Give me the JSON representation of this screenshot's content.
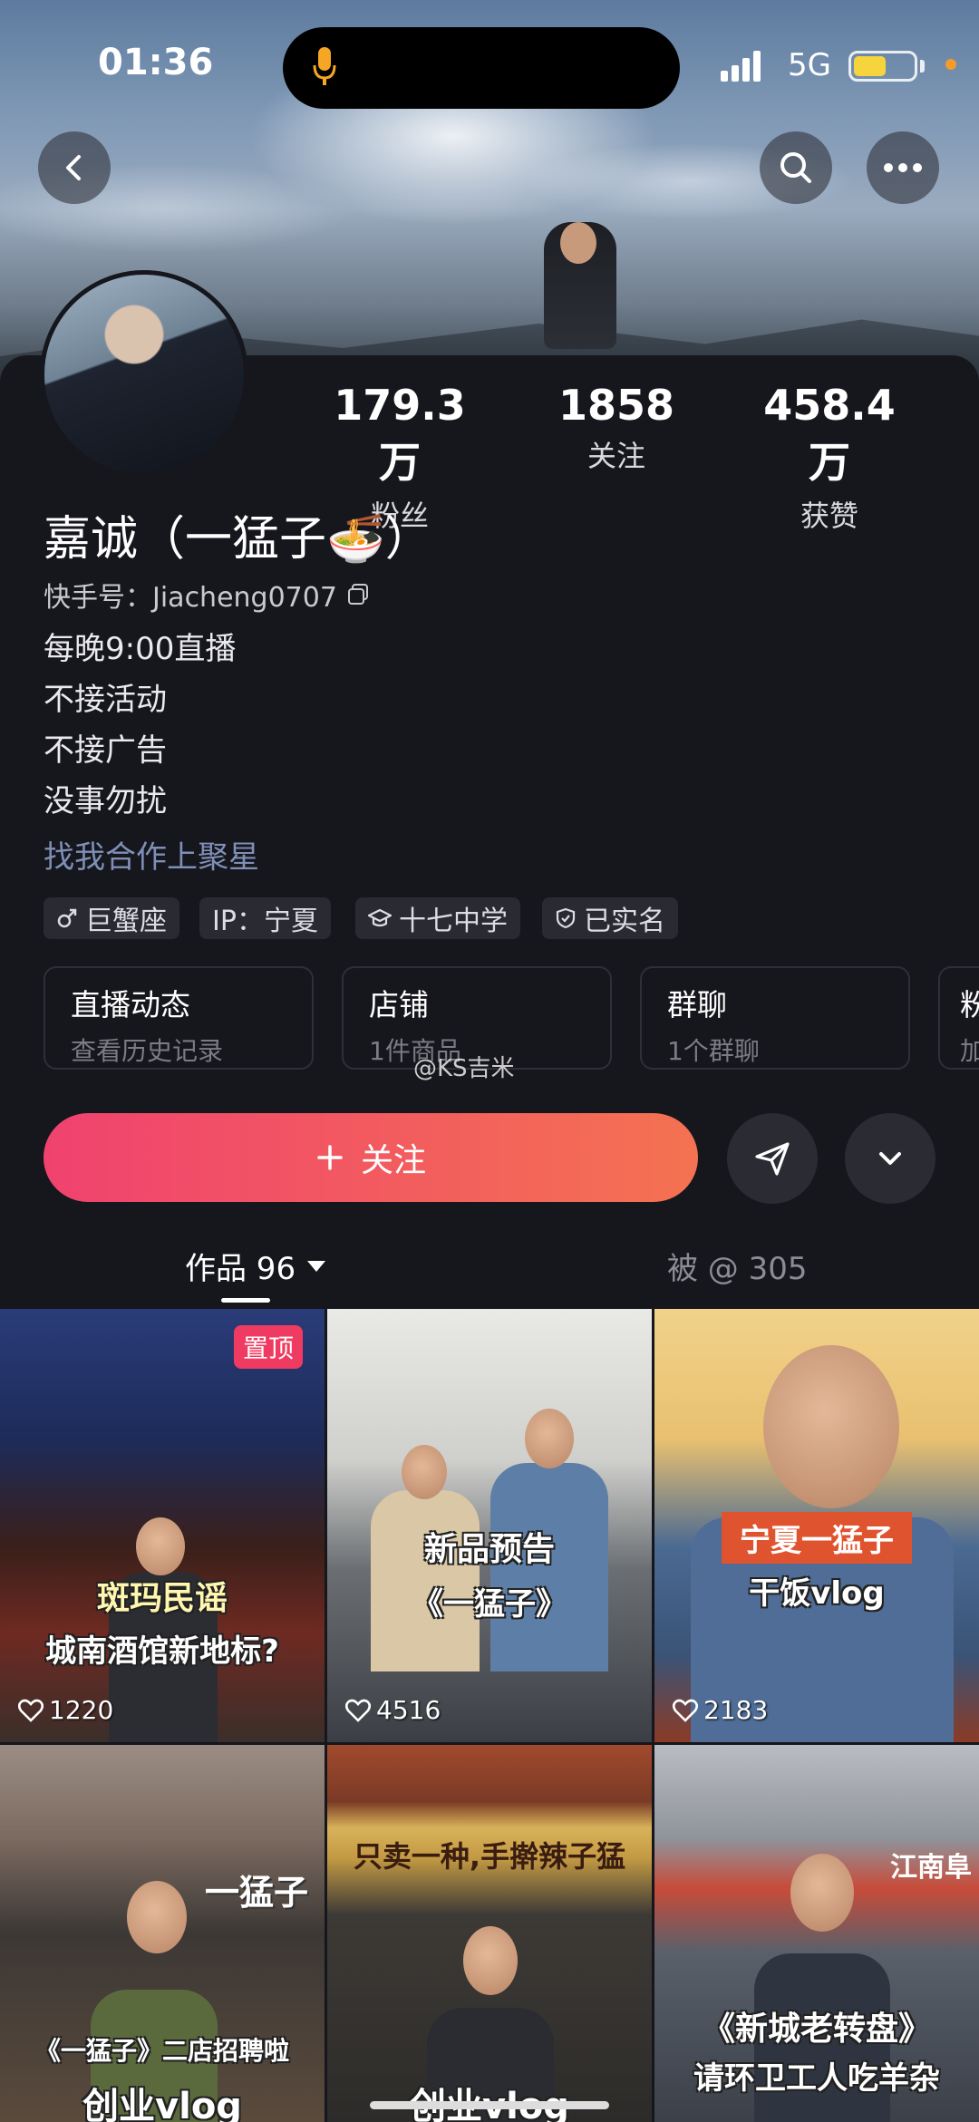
{
  "status_bar": {
    "time": "01:36",
    "network": "5G"
  },
  "profile": {
    "name": "嘉诚（一猛子🍜）",
    "kuaishou_id": "快手号：Jiacheng0707",
    "bio": [
      "每晚9:00直播",
      "不接活动",
      "不接广告",
      "没事勿扰"
    ],
    "link": "找我合作上聚星",
    "stats": [
      {
        "value": "179.3万",
        "label": "粉丝"
      },
      {
        "value": "1858",
        "label": "关注"
      },
      {
        "value": "458.4万",
        "label": "获赞"
      }
    ],
    "tags": [
      "巨蟹座",
      "IP：宁夏",
      "十七中学",
      "已实名"
    ]
  },
  "cards": [
    {
      "title": "直播动态",
      "sub": "查看历史记录"
    },
    {
      "title": "店铺",
      "sub": "1件商品"
    },
    {
      "title": "群聊",
      "sub": "1个群聊"
    },
    {
      "title": "粉",
      "sub": "加"
    }
  ],
  "watermark": "@KS吉米",
  "actions": {
    "follow": "关注"
  },
  "tabs": [
    {
      "label": "作品 96"
    },
    {
      "label": "被 @ 305"
    }
  ],
  "videos": [
    {
      "line1": "斑玛民谣",
      "line2": "城南酒馆新地标?",
      "likes": "1220",
      "pinned": "置顶"
    },
    {
      "line1": "新品预告",
      "line2": "《一猛子》",
      "likes": "4516"
    },
    {
      "line1": "宁夏一猛子",
      "line2": "干饭vlog",
      "likes": "2183"
    },
    {
      "sign": "一猛子",
      "line1": "《一猛子》二店招聘啦",
      "line2": "创业vlog"
    },
    {
      "sign": "只卖一种,手擀辣子猛",
      "line2": "创业vlog"
    },
    {
      "sign": "江南阜",
      "line1": "《新城老转盘》",
      "line2": "请环卫工人吃羊杂"
    }
  ]
}
